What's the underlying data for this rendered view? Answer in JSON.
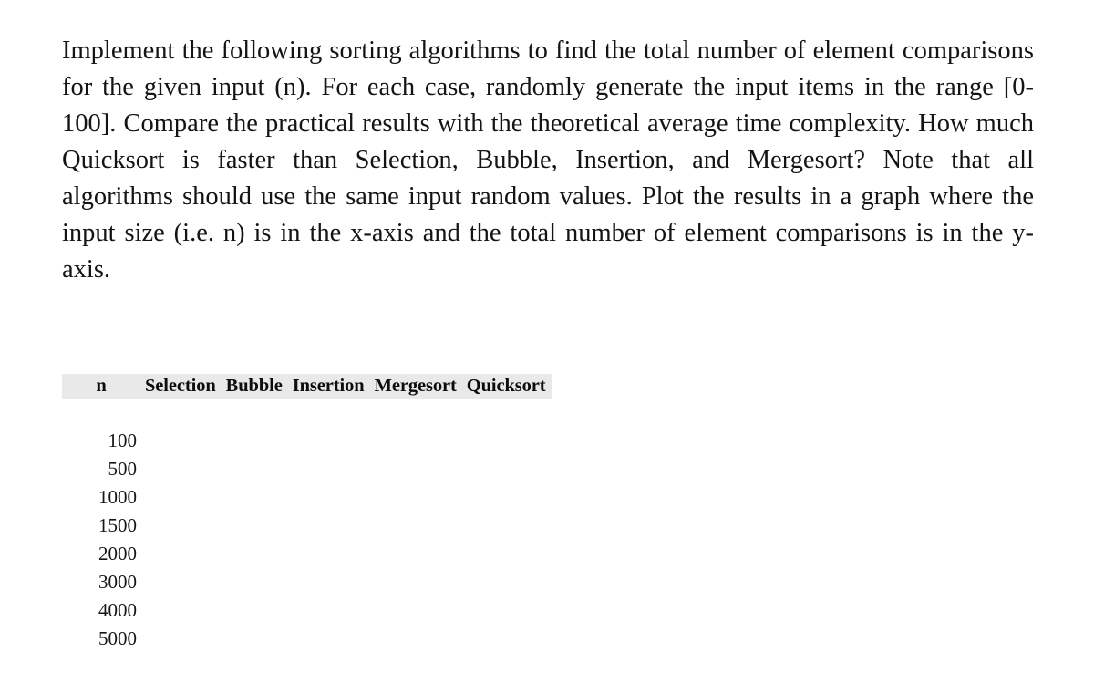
{
  "document": {
    "background_color": "#ffffff",
    "text_color": "#141414",
    "question": {
      "body": "Implement the following sorting algorithms to find the total number of element comparisons for the given input (n). For each case, randomly generate the input items in the range [0-100]. Compare the practical results with the theoretical average time complexity. How much Quicksort is faster than Selection, Bubble, Insertion, and Mergesort? Note that all algorithms should use the same input random values. Plot the results in a graph where the input size (i.e. n) is in the x-axis and the total number of element comparisons is in the y-axis."
    },
    "results_table": {
      "header_background_color": "#e9e9e9",
      "columns": [
        {
          "key": "n",
          "label": "n"
        },
        {
          "key": "selection",
          "label": "Selection"
        },
        {
          "key": "bubble",
          "label": "Bubble"
        },
        {
          "key": "insertion",
          "label": "Insertion"
        },
        {
          "key": "mergesort",
          "label": "Mergesort"
        },
        {
          "key": "quicksort",
          "label": "Quicksort"
        }
      ],
      "rows": [
        {
          "n": "100",
          "selection": "",
          "bubble": "",
          "insertion": "",
          "mergesort": "",
          "quicksort": ""
        },
        {
          "n": "500",
          "selection": "",
          "bubble": "",
          "insertion": "",
          "mergesort": "",
          "quicksort": ""
        },
        {
          "n": "1000",
          "selection": "",
          "bubble": "",
          "insertion": "",
          "mergesort": "",
          "quicksort": ""
        },
        {
          "n": "1500",
          "selection": "",
          "bubble": "",
          "insertion": "",
          "mergesort": "",
          "quicksort": ""
        },
        {
          "n": "2000",
          "selection": "",
          "bubble": "",
          "insertion": "",
          "mergesort": "",
          "quicksort": ""
        },
        {
          "n": "3000",
          "selection": "",
          "bubble": "",
          "insertion": "",
          "mergesort": "",
          "quicksort": ""
        },
        {
          "n": "4000",
          "selection": "",
          "bubble": "",
          "insertion": "",
          "mergesort": "",
          "quicksort": ""
        },
        {
          "n": "5000",
          "selection": "",
          "bubble": "",
          "insertion": "",
          "mergesort": "",
          "quicksort": ""
        }
      ]
    }
  }
}
